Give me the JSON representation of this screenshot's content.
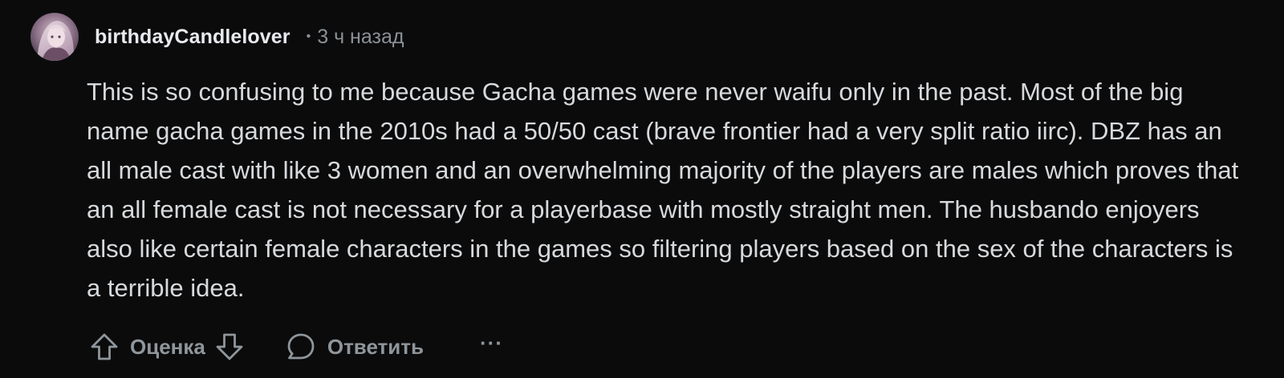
{
  "comment": {
    "author": "birthdayCandlelover",
    "separator": "•",
    "timestamp": "3 ч назад",
    "text": "This is so confusing to me because Gacha games were never waifu only in the past. Most of the big name gacha games in the 2010s had a 50/50 cast (brave frontier had a very split ratio iirc). DBZ has an all male cast with like 3 women and an overwhelming majority of the players are males which proves that an all female cast is not necessary for a playerbase with mostly straight men. The husbando enjoyers also like certain female characters in the games so filtering players based on the sex of the characters is a terrible idea."
  },
  "actions": {
    "vote_label": "Оценка",
    "reply_label": "Ответить",
    "more_label": "···"
  },
  "icons": {
    "avatar": "user-avatar",
    "upvote": "upvote-arrow-icon",
    "downvote": "downvote-arrow-icon",
    "reply": "speech-bubble-icon",
    "more": "more-options-icon"
  },
  "colors": {
    "background": "#0b0b0c",
    "text": "#d7dadc",
    "muted": "#8b9196"
  }
}
